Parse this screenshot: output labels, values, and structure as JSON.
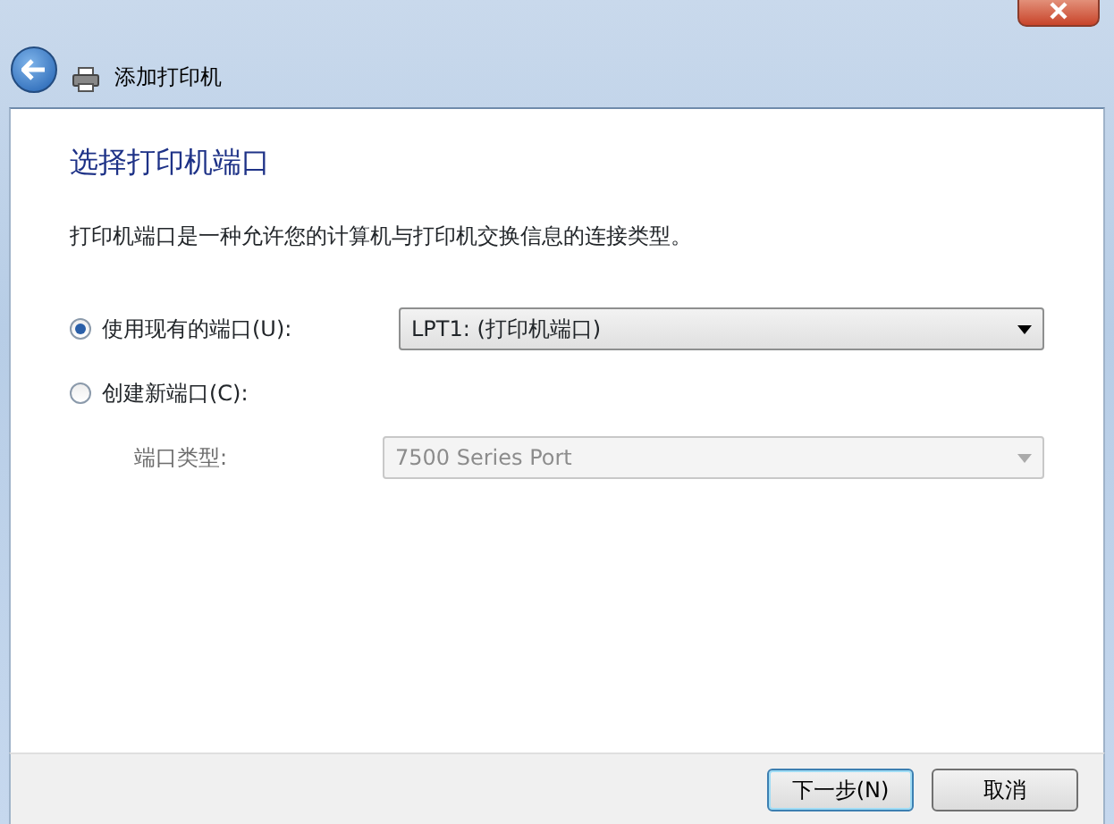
{
  "window": {
    "title": "添加打印机"
  },
  "heading": "选择打印机端口",
  "description": "打印机端口是一种允许您的计算机与打印机交换信息的连接类型。",
  "options": [
    {
      "label": "使用现有的端口(U):",
      "selected": true
    },
    {
      "label": "创建新端口(C):",
      "selected": false
    }
  ],
  "existing_port": {
    "value": "LPT1: (打印机端口)",
    "disabled": false
  },
  "new_port": {
    "label": "端口类型:",
    "value": "7500 Series Port",
    "disabled": true
  },
  "buttons": [
    {
      "label": "下一步(N)",
      "default": true
    },
    {
      "label": "取消",
      "default": false
    }
  ]
}
